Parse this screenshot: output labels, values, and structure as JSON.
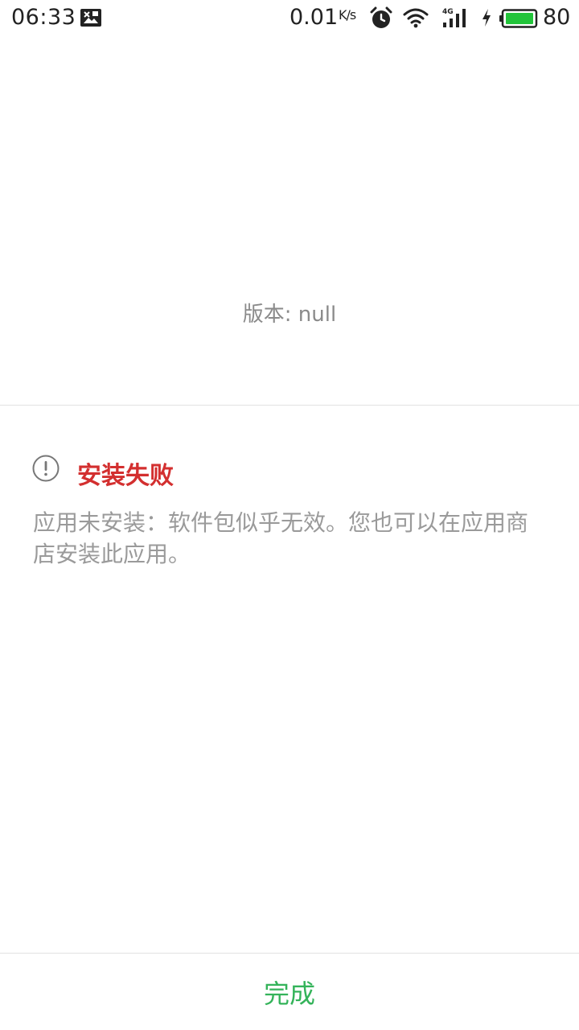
{
  "status_bar": {
    "time": "06:33",
    "network_speed": "0.01",
    "speed_unit": "K/s",
    "network_type": "4G",
    "battery_level": "80",
    "icons": [
      "notification-image-icon",
      "alarm-icon",
      "wifi-icon",
      "signal-4g-icon",
      "charging-icon",
      "battery-icon"
    ]
  },
  "version": {
    "text": "版本: null"
  },
  "result": {
    "icon": "info-circle-icon",
    "title": "安装失败",
    "title_color": "#d32f2f",
    "message": "应用未安装：软件包似乎无效。您也可以在应用商店安装此应用。"
  },
  "footer": {
    "done_label": "完成",
    "accent_color": "#34b35a"
  }
}
